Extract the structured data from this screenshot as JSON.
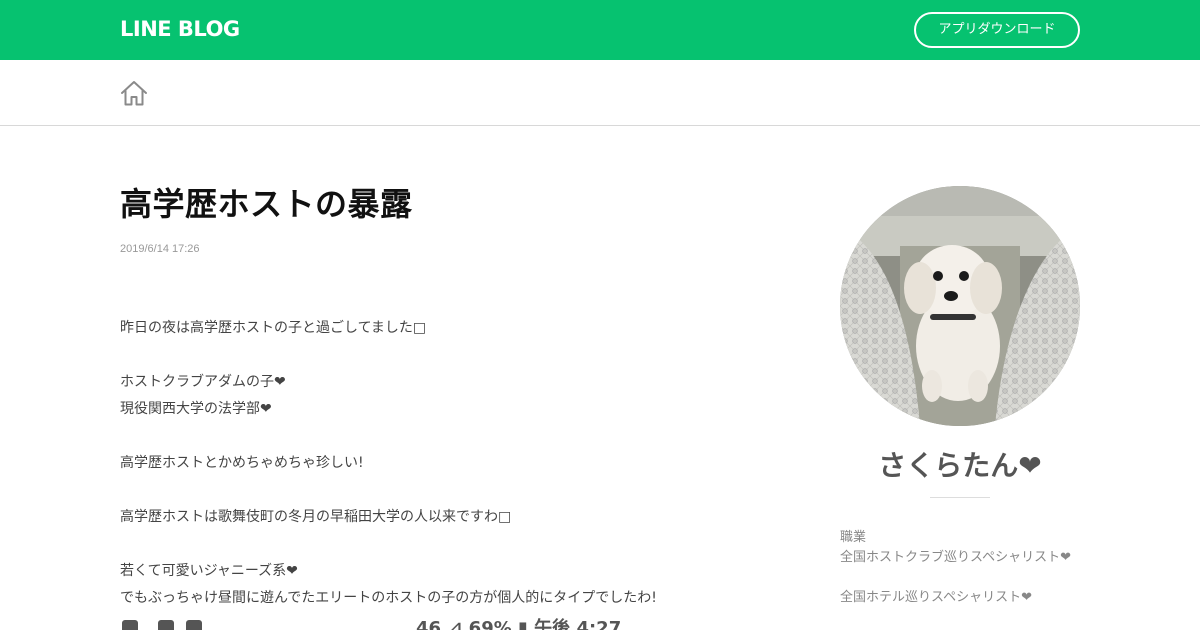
{
  "header": {
    "logo": "LINE BLOG",
    "app_download_label": "アプリダウンロード",
    "brand_color": "#06c270"
  },
  "nav": {
    "home_icon": "home-icon"
  },
  "article": {
    "title": "高学歴ホストの暴露",
    "date": "2019/6/14 17:26",
    "lines": [
      "昨日の夜は高学歴ホストの子と過ごしてました□",
      "",
      "ホストクラブアダムの子❤",
      "現役関西大学の法学部❤",
      "",
      "高学歴ホストとかめちゃめちゃ珍しい!",
      "",
      "高学歴ホストは歌舞伎町の冬月の早稲田大学の人以来ですわ□",
      "",
      "若くて可愛いジャニーズ系❤",
      "でもぶっちゃけ昼間に遊んでたエリートのホストの子の方が個人的にタイプでしたわ!"
    ],
    "partial_bottom_text": "46 ⊿ 69% ▮ 午後 4:27"
  },
  "sidebar": {
    "author_name": "さくらたん❤",
    "profile_lines": [
      "職業",
      "全国ホストクラブ巡りスペシャリスト❤",
      "",
      "全国ホテル巡りスペシャリスト❤"
    ]
  }
}
